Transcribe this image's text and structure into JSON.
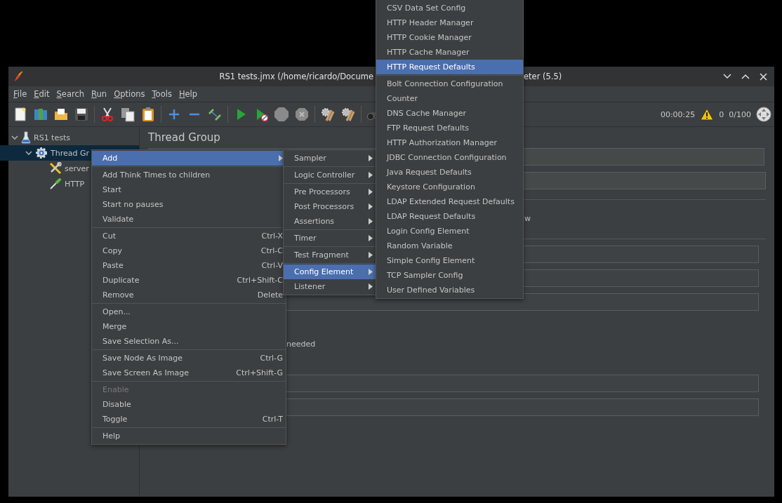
{
  "window": {
    "title_left": "RS1 tests.jmx (/home/ricardo/Docume",
    "title_right": "eter (5.5)"
  },
  "menu_bar": [
    "File",
    "Edit",
    "Search",
    "Run",
    "Options",
    "Tools",
    "Help"
  ],
  "toolbar": {
    "elapsed": "00:00:25",
    "warnings": "0",
    "threads": "0/100"
  },
  "tree": [
    {
      "label": "RS1 tests",
      "kind": "test-plan",
      "selected": false,
      "expanded": true,
      "children": [
        {
          "label": "Thread Gr",
          "kind": "thread-group",
          "selected": true,
          "expanded": true,
          "children": [
            {
              "label": "server",
              "kind": "config",
              "selected": false
            },
            {
              "label": "HTTP",
              "kind": "sampler",
              "selected": false
            }
          ]
        }
      ]
    }
  ],
  "panel": {
    "title": "Thread Group",
    "visible_texts": [
      "w",
      "needed"
    ]
  },
  "context_menu": {
    "groups": [
      [
        {
          "label": "Add",
          "submenu": true,
          "selected": true,
          "disabled": false
        }
      ],
      [
        {
          "label": "Add Think Times to children",
          "submenu": false,
          "selected": false,
          "disabled": false
        },
        {
          "label": "Start",
          "submenu": false,
          "selected": false,
          "disabled": false
        },
        {
          "label": "Start no pauses",
          "submenu": false,
          "selected": false,
          "disabled": false
        },
        {
          "label": "Validate",
          "submenu": false,
          "selected": false,
          "disabled": false
        }
      ],
      [
        {
          "label": "Cut",
          "shortcut": "Ctrl-X",
          "submenu": false,
          "selected": false,
          "disabled": false
        },
        {
          "label": "Copy",
          "shortcut": "Ctrl-C",
          "submenu": false,
          "selected": false,
          "disabled": false
        },
        {
          "label": "Paste",
          "shortcut": "Ctrl-V",
          "submenu": false,
          "selected": false,
          "disabled": false
        },
        {
          "label": "Duplicate",
          "shortcut": "Ctrl+Shift-C",
          "submenu": false,
          "selected": false,
          "disabled": false
        },
        {
          "label": "Remove",
          "shortcut": "Delete",
          "submenu": false,
          "selected": false,
          "disabled": false
        }
      ],
      [
        {
          "label": "Open...",
          "submenu": false,
          "selected": false,
          "disabled": false
        },
        {
          "label": "Merge",
          "submenu": false,
          "selected": false,
          "disabled": false
        },
        {
          "label": "Save Selection As...",
          "submenu": false,
          "selected": false,
          "disabled": false
        }
      ],
      [
        {
          "label": "Save Node As Image",
          "shortcut": "Ctrl-G",
          "submenu": false,
          "selected": false,
          "disabled": false
        },
        {
          "label": "Save Screen As Image",
          "shortcut": "Ctrl+Shift-G",
          "submenu": false,
          "selected": false,
          "disabled": false
        }
      ],
      [
        {
          "label": "Enable",
          "submenu": false,
          "selected": false,
          "disabled": true
        },
        {
          "label": "Disable",
          "submenu": false,
          "selected": false,
          "disabled": false
        },
        {
          "label": "Toggle",
          "shortcut": "Ctrl-T",
          "submenu": false,
          "selected": false,
          "disabled": false
        }
      ],
      [
        {
          "label": "Help",
          "submenu": false,
          "selected": false,
          "disabled": false
        }
      ]
    ]
  },
  "add_submenu": {
    "groups": [
      [
        {
          "label": "Sampler",
          "submenu": true,
          "selected": false
        }
      ],
      [
        {
          "label": "Logic Controller",
          "submenu": true,
          "selected": false
        }
      ],
      [
        {
          "label": "Pre Processors",
          "submenu": true,
          "selected": false
        },
        {
          "label": "Post Processors",
          "submenu": true,
          "selected": false
        },
        {
          "label": "Assertions",
          "submenu": true,
          "selected": false
        }
      ],
      [
        {
          "label": "Timer",
          "submenu": true,
          "selected": false
        }
      ],
      [
        {
          "label": "Test Fragment",
          "submenu": true,
          "selected": false
        }
      ],
      [
        {
          "label": "Config Element",
          "submenu": true,
          "selected": true
        },
        {
          "label": "Listener",
          "submenu": true,
          "selected": false
        }
      ]
    ]
  },
  "config_submenu": {
    "groups": [
      [
        {
          "label": "CSV Data Set Config",
          "selected": false
        },
        {
          "label": "HTTP Header Manager",
          "selected": false
        },
        {
          "label": "HTTP Cookie Manager",
          "selected": false
        },
        {
          "label": "HTTP Cache Manager",
          "selected": false
        },
        {
          "label": "HTTP Request Defaults",
          "selected": true
        }
      ],
      [
        {
          "label": "Bolt Connection Configuration",
          "selected": false
        },
        {
          "label": "Counter",
          "selected": false
        },
        {
          "label": "DNS Cache Manager",
          "selected": false
        },
        {
          "label": "FTP Request Defaults",
          "selected": false
        },
        {
          "label": "HTTP Authorization Manager",
          "selected": false
        },
        {
          "label": "JDBC Connection Configuration",
          "selected": false
        },
        {
          "label": "Java Request Defaults",
          "selected": false
        },
        {
          "label": "Keystore Configuration",
          "selected": false
        },
        {
          "label": "LDAP Extended Request Defaults",
          "selected": false
        },
        {
          "label": "LDAP Request Defaults",
          "selected": false
        },
        {
          "label": "Login Config Element",
          "selected": false
        },
        {
          "label": "Random Variable",
          "selected": false
        },
        {
          "label": "Simple Config Element",
          "selected": false
        },
        {
          "label": "TCP Sampler Config",
          "selected": false
        },
        {
          "label": "User Defined Variables",
          "selected": false
        }
      ]
    ]
  }
}
